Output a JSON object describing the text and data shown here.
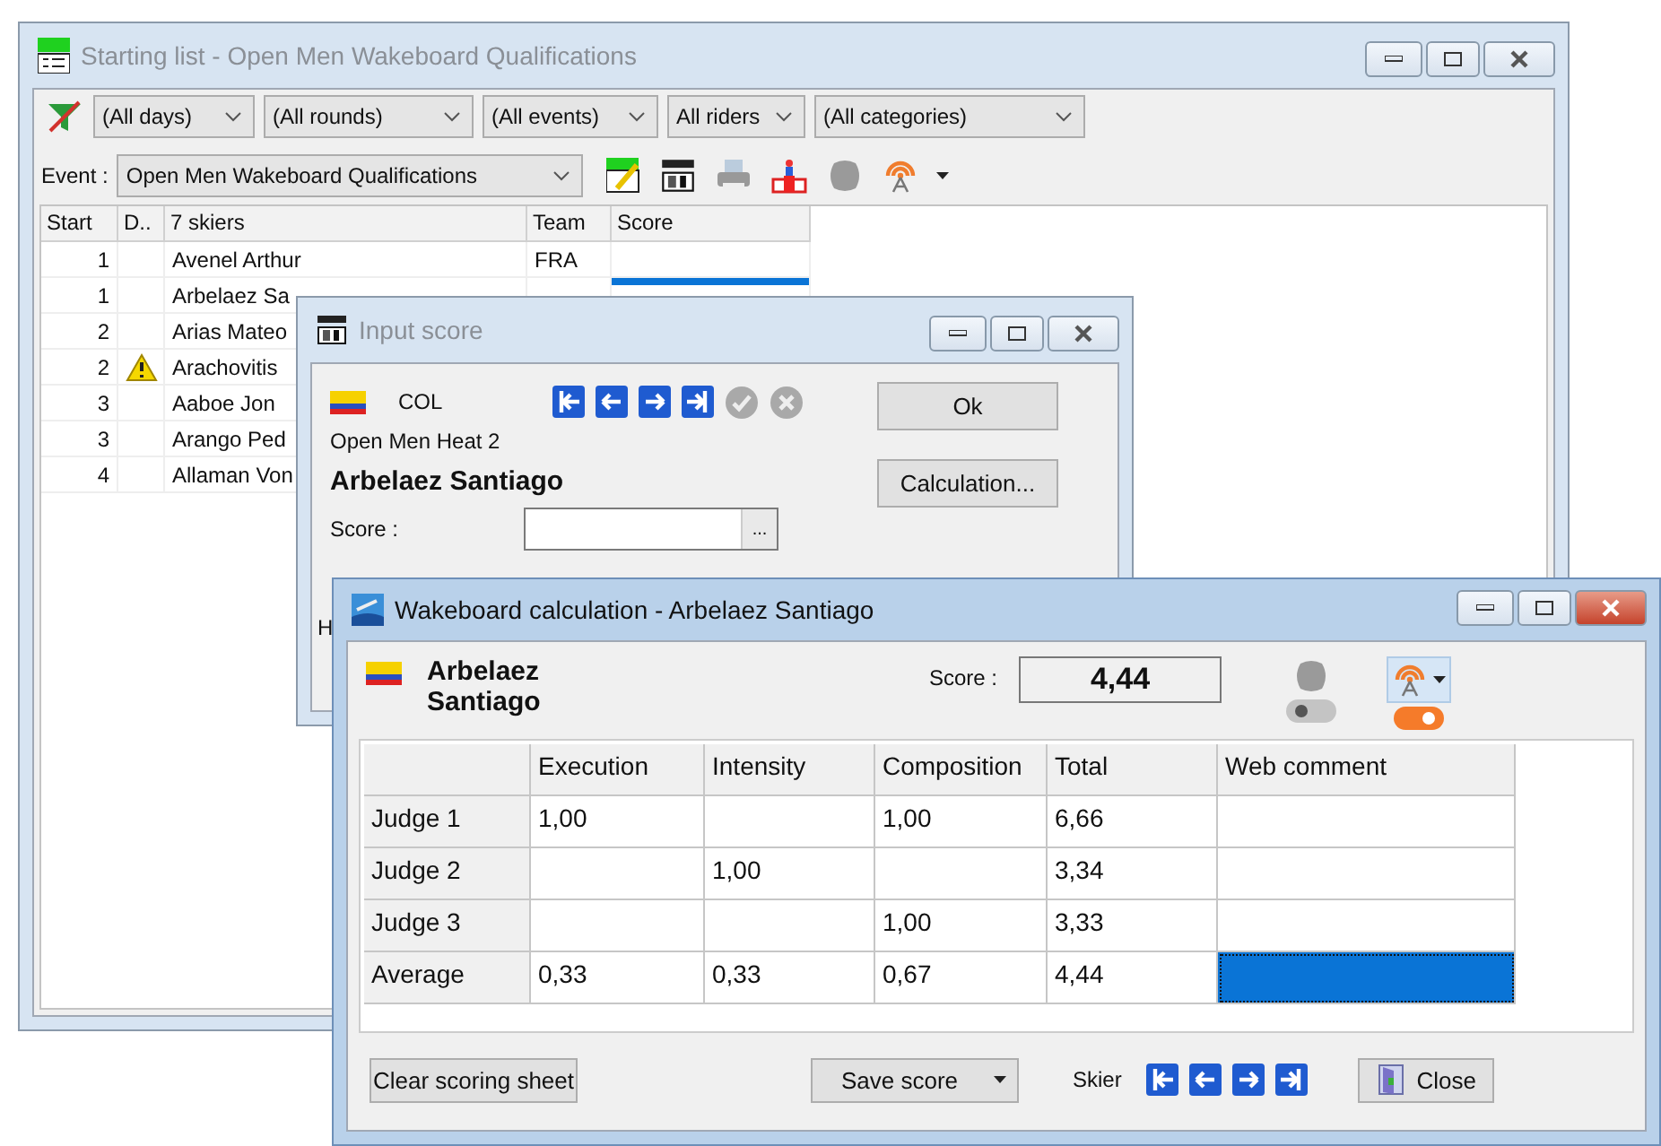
{
  "starting_list_window": {
    "title": "Starting list - Open Men Wakeboard Qualifications",
    "active": false,
    "filters": [
      "(All days)",
      "(All rounds)",
      "(All events)",
      "All riders",
      "(All categories)"
    ],
    "event_label": "Event :",
    "event_value": "Open Men Wakeboard Qualifications",
    "table": {
      "columns": [
        "Start",
        "D..",
        "7 skiers",
        "Team",
        "Score"
      ],
      "rows": [
        {
          "start": "1",
          "warning": false,
          "name": "Avenel Arthur",
          "team": "FRA",
          "selected": false
        },
        {
          "start": "1",
          "warning": false,
          "name": "Arbelaez Sa",
          "selected": true
        },
        {
          "start": "2",
          "warning": false,
          "name": "Arias Mateo"
        },
        {
          "start": "2",
          "warning": true,
          "name": "Arachovitis"
        },
        {
          "start": "3",
          "warning": false,
          "name": "Aaboe Jon"
        },
        {
          "start": "3",
          "warning": false,
          "name": "Arango Ped"
        },
        {
          "start": "4",
          "warning": false,
          "name": "Allaman Von"
        }
      ]
    }
  },
  "input_score_window": {
    "title": "Input score",
    "active": false,
    "country": "COL",
    "heat": "Open Men Heat 2",
    "skier": "Arbelaez Santiago",
    "score_label": "Score :",
    "browse_button": "...",
    "buttons": [
      "Ok",
      "Calculation..."
    ],
    "confirm_disabled": true,
    "hidden_label": "H"
  },
  "calculation_window": {
    "title": "Wakeboard calculation - Arbelaez Santiago",
    "active": true,
    "skier": "Arbelaez Santiago",
    "score_label": "Score :",
    "score": "4,44",
    "toggles": [
      {
        "kind": "cloud",
        "on": false
      },
      {
        "kind": "broadcast",
        "on": true
      }
    ],
    "grid": {
      "columns": [
        "Execution",
        "Intensity",
        "Composition",
        "Total",
        "Web comment"
      ],
      "rows": [
        {
          "label": "Judge 1",
          "cells": [
            "1,00",
            null,
            "1,00",
            "6,66"
          ],
          "comment_selected": false
        },
        {
          "label": "Judge 2",
          "cells": [
            null,
            "1,00",
            null,
            "3,34"
          ],
          "comment_selected": false
        },
        {
          "label": "Judge 3",
          "cells": [
            null,
            null,
            "1,00",
            "3,33"
          ],
          "comment_selected": false
        },
        {
          "label": "Average",
          "cells": [
            "0,33",
            "0,33",
            "0,67",
            "4,44"
          ],
          "comment_selected": true
        }
      ]
    },
    "footer": {
      "clear_button": "Clear scoring sheet",
      "save_button": "Save score",
      "skier_label": "Skier",
      "close_button": "Close"
    }
  }
}
